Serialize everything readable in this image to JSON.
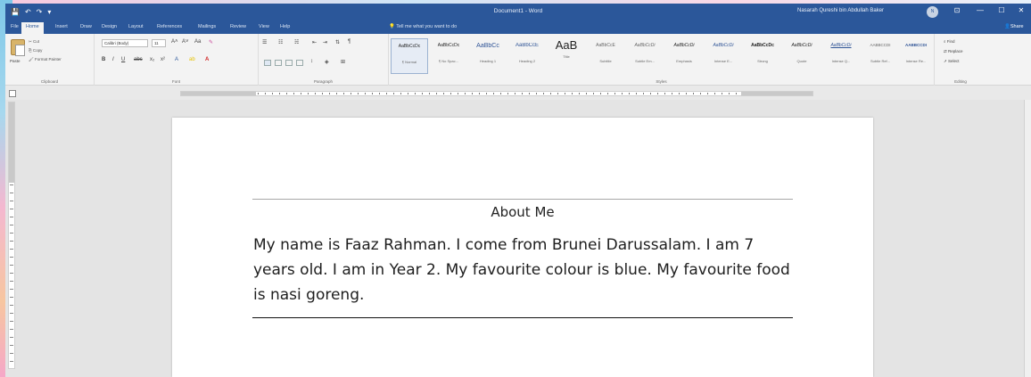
{
  "titlebar": {
    "doc_title": "Document1 - Word",
    "user": "Nasarah Qureshi bin Abdullah Baker",
    "avatar_initials": "N",
    "quick_access": [
      "💾",
      "↶",
      "↷",
      "▾"
    ],
    "window_buttons": [
      "⊡",
      "—",
      "☐",
      "✕"
    ]
  },
  "tabs": [
    "File",
    "Home",
    "Insert",
    "Draw",
    "Design",
    "Layout",
    "References",
    "Mailings",
    "Review",
    "View",
    "Help"
  ],
  "active_tab": "Home",
  "tell_me": "Tell me what you want to do",
  "share": "Share",
  "ribbon": {
    "clipboard": {
      "paste": "Paste",
      "cut": "Cut",
      "copy": "Copy",
      "format_painter": "Format Painter",
      "label": "Clipboard"
    },
    "font": {
      "name": "Calibri (Body)",
      "size": "11",
      "label": "Font"
    },
    "paragraph": {
      "label": "Paragraph"
    },
    "styles": {
      "label": "Styles",
      "items": [
        {
          "preview": "AaBbCcDc",
          "name": "¶ Normal"
        },
        {
          "preview": "AaBbCcDc",
          "name": "¶ No Spac..."
        },
        {
          "preview": "AaBbCc",
          "name": "Heading 1"
        },
        {
          "preview": "AaBbCcE",
          "name": "Heading 2"
        },
        {
          "preview": "AaB",
          "name": "Title"
        },
        {
          "preview": "AaBbCcE",
          "name": "Subtitle"
        },
        {
          "preview": "AaBbCcDi",
          "name": "Subtle Em..."
        },
        {
          "preview": "AaBbCcDi",
          "name": "Emphasis"
        },
        {
          "preview": "AaBbCcDi",
          "name": "Intense E..."
        },
        {
          "preview": "AaBbCcDc",
          "name": "Strong"
        },
        {
          "preview": "AaBbCcDi",
          "name": "Quote"
        },
        {
          "preview": "AaBbCcDi",
          "name": "Intense Q..."
        },
        {
          "preview": "AABBCCDI",
          "name": "Subtle Ref..."
        },
        {
          "preview": "AABBCCDI",
          "name": "Intense Re..."
        }
      ]
    },
    "editing": {
      "find": "Find",
      "replace": "Replace",
      "select": "Select",
      "label": "Editing"
    }
  },
  "document": {
    "heading": "About Me",
    "body": "My name is Faaz Rahman. I come from Brunei Darussalam. I am 7 years old. I am in Year 2. My favourite colour is blue. My favourite food is nasi goreng."
  },
  "colors": {
    "accent": "#2b579a",
    "ribbon_bg": "#f3f3f3",
    "canvas_bg": "#e4e4e4"
  }
}
